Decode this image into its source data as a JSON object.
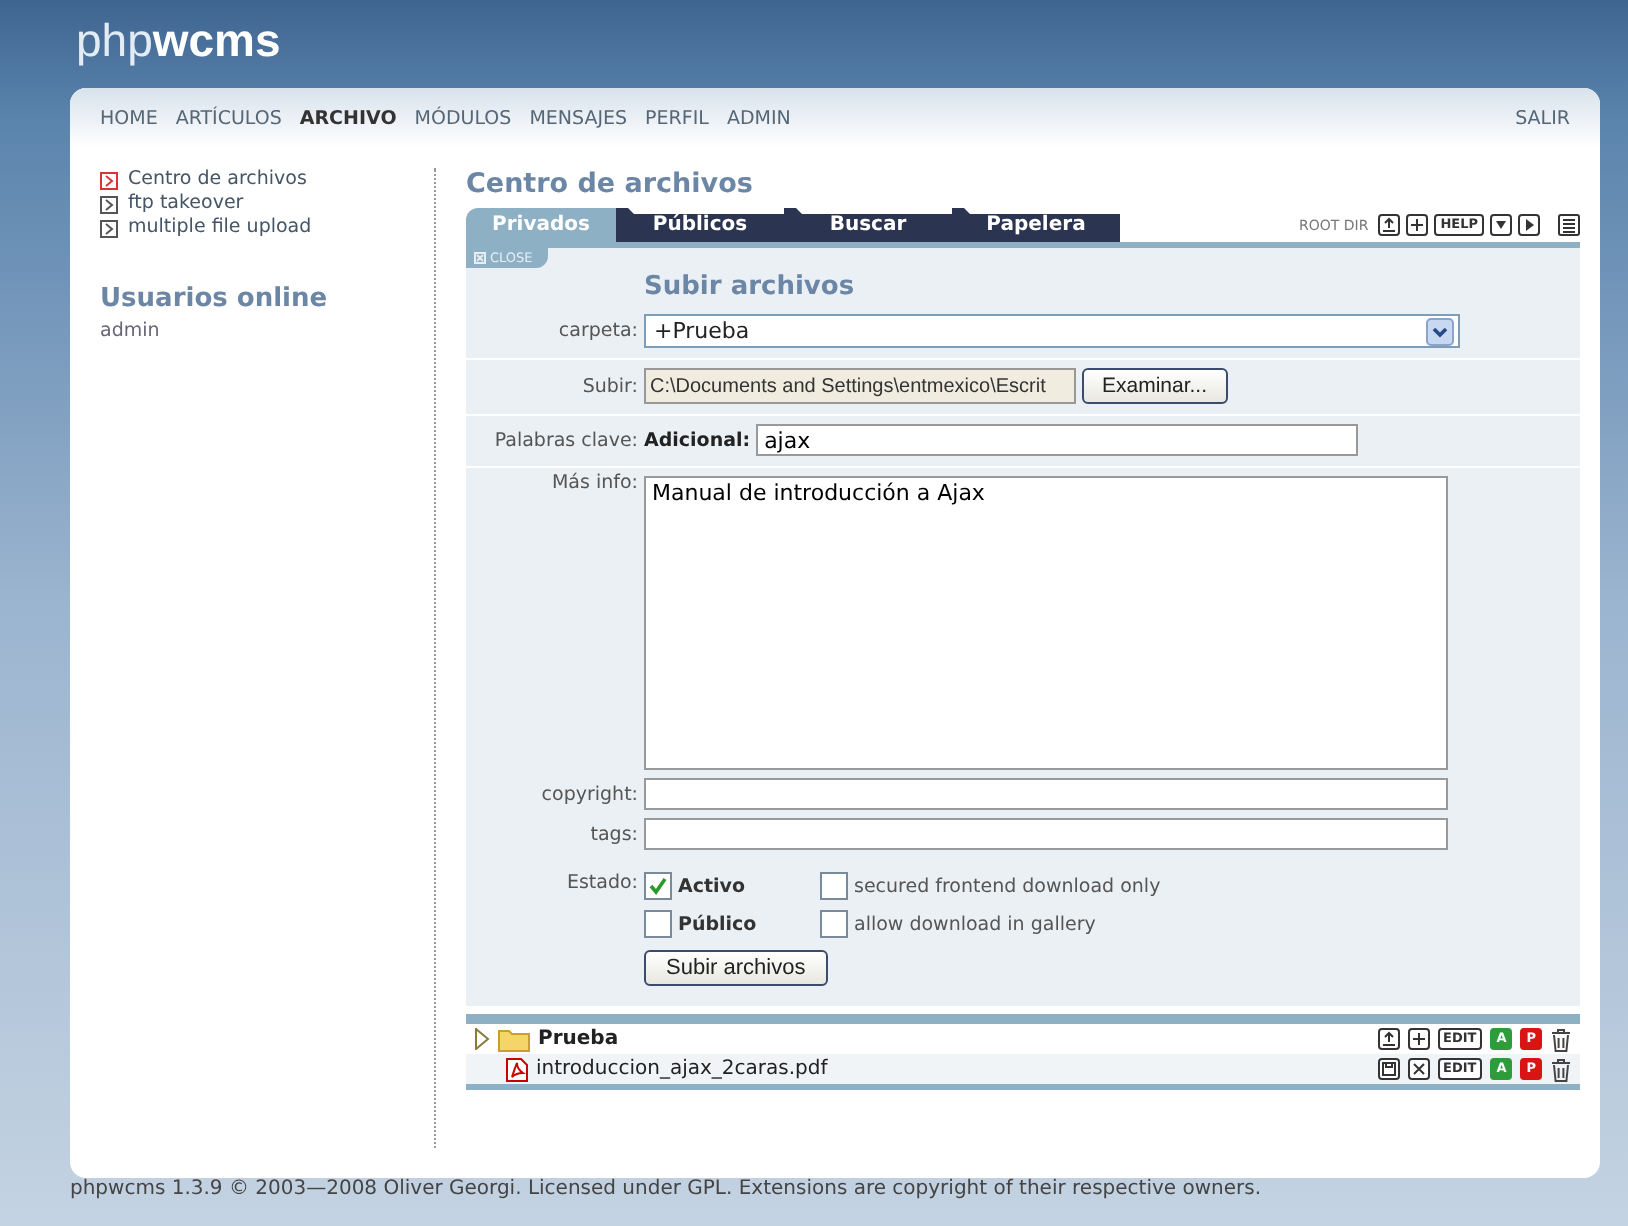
{
  "logo": {
    "light": "php",
    "bold": "wcms"
  },
  "nav": {
    "items": [
      {
        "label": "HOME",
        "selected": false
      },
      {
        "label": "ARTÍCULOS",
        "selected": false
      },
      {
        "label": "ARCHIVO",
        "selected": true
      },
      {
        "label": "MÓDULOS",
        "selected": false
      },
      {
        "label": "MENSAJES",
        "selected": false
      },
      {
        "label": "PERFIL",
        "selected": false
      },
      {
        "label": "ADMIN",
        "selected": false
      }
    ],
    "exit": "SALIR"
  },
  "sidebar": {
    "links": [
      {
        "label": "Centro de archivos",
        "selected": true
      },
      {
        "label": "ftp takeover",
        "selected": false
      },
      {
        "label": "multiple file upload",
        "selected": false
      }
    ],
    "online_title": "Usuarios online",
    "users": [
      "admin"
    ]
  },
  "main": {
    "title": "Centro de archivos",
    "tabs": [
      {
        "label": "Privados",
        "selected": true
      },
      {
        "label": "Públicos",
        "selected": false
      },
      {
        "label": "Buscar",
        "selected": false
      },
      {
        "label": "Papelera",
        "selected": false
      }
    ],
    "root_dir": "ROOT DIR",
    "toolbar": [
      {
        "kind": "upload"
      },
      {
        "kind": "plus"
      },
      {
        "kind": "text",
        "label": "HELP"
      },
      {
        "kind": "down"
      },
      {
        "kind": "right"
      },
      {
        "kind": "list"
      }
    ],
    "close": "CLOSE",
    "form": {
      "heading": "Subir archivos",
      "carpeta": {
        "label": "carpeta:",
        "value": "+Prueba"
      },
      "subir": {
        "label": "Subir:",
        "value": "C:\\Documents and Settings\\entmexico\\Escrit",
        "button": "Examinar..."
      },
      "keywords": {
        "label": "Palabras clave:",
        "sublabel": "Adicional:",
        "value": "ajax"
      },
      "info": {
        "label": "Más info:",
        "value": "Manual de introducción a Ajax"
      },
      "copyright": {
        "label": "copyright:"
      },
      "tags": {
        "label": "tags:"
      },
      "estado": {
        "label": "Estado:",
        "options": [
          {
            "label": "Activo",
            "checked": true,
            "bold": true
          },
          {
            "label": "secured frontend download only",
            "checked": false,
            "bold": false
          },
          {
            "label": "Público",
            "checked": false,
            "bold": true
          },
          {
            "label": "allow download in gallery",
            "checked": false,
            "bold": false
          }
        ]
      },
      "submit": "Subir archivos"
    },
    "files": [
      {
        "kind": "folder",
        "name": "Prueba",
        "expanded": false,
        "actions": [
          {
            "kind": "upload"
          },
          {
            "kind": "plus"
          },
          {
            "kind": "text",
            "label": "EDIT"
          },
          {
            "kind": "green",
            "label": "A"
          },
          {
            "kind": "red",
            "label": "P"
          },
          {
            "kind": "trash"
          }
        ]
      },
      {
        "kind": "pdf",
        "name": "introduccion_ajax_2caras.pdf",
        "actions": [
          {
            "kind": "save"
          },
          {
            "kind": "cross"
          },
          {
            "kind": "text",
            "label": "EDIT"
          },
          {
            "kind": "green",
            "label": "A"
          },
          {
            "kind": "red",
            "label": "P"
          },
          {
            "kind": "trash"
          }
        ]
      }
    ]
  },
  "footer": "phpwcms 1.3.9 © 2003—2008 Oliver Georgi. Licensed under GPL. Extensions are copyright of their respective owners."
}
